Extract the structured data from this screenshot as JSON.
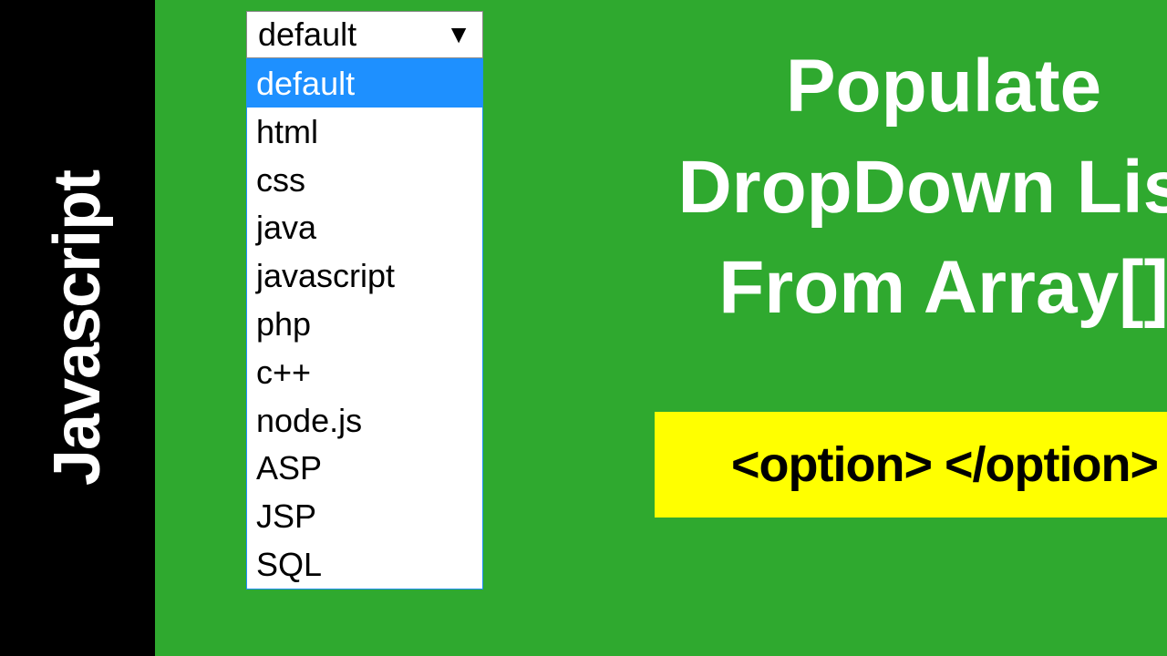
{
  "sidebar": {
    "label": "Javascript"
  },
  "dropdown": {
    "selected": "default",
    "options": [
      {
        "label": "default",
        "selected": true
      },
      {
        "label": "html",
        "selected": false
      },
      {
        "label": "css",
        "selected": false
      },
      {
        "label": "java",
        "selected": false
      },
      {
        "label": "javascript",
        "selected": false
      },
      {
        "label": "php",
        "selected": false
      },
      {
        "label": "c++",
        "selected": false
      },
      {
        "label": "node.js",
        "selected": false
      },
      {
        "label": "ASP",
        "selected": false
      },
      {
        "label": "JSP",
        "selected": false
      },
      {
        "label": "SQL",
        "selected": false
      }
    ]
  },
  "title": {
    "line1": "Populate",
    "line2": "DropDown List",
    "line3": "From Array[]"
  },
  "code_hint": "<option>  </option>"
}
